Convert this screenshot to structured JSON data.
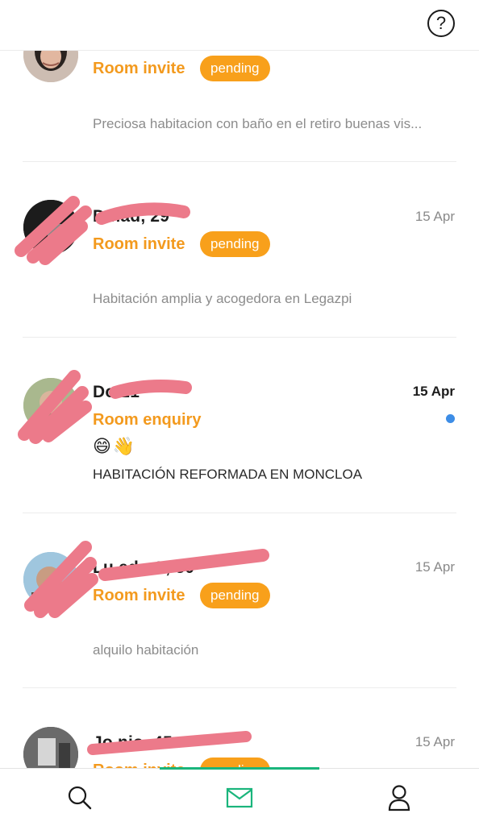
{
  "header": {
    "help_icon": "help-circle-icon",
    "help_label": "?"
  },
  "conversations": [
    {
      "name": "",
      "date": "",
      "type": "Room invite",
      "status": "pending",
      "preview": "Preciosa habitacion con baño en el retiro buenas vis..."
    },
    {
      "name": "D        nad, 29",
      "date": "15 Apr",
      "type": "Room invite",
      "status": "pending",
      "preview": "Habitación amplia y acogedora en Legazpi"
    },
    {
      "name": "Do      21",
      "date": "15 Apr",
      "type": "Room enquiry",
      "status": "",
      "emoji": "😄👋",
      "preview": "HABITACIÓN REFORMADA EN MONCLOA",
      "unread": true
    },
    {
      "name": "Lu        edo S, 50",
      "date": "15 Apr",
      "type": "Room invite",
      "status": "pending",
      "preview": "alquilo habitación"
    },
    {
      "name": "Jo          nio, 45",
      "date": "15 Apr",
      "type": "Room invite",
      "status": "pending",
      "preview": ""
    }
  ],
  "tabbar": {
    "tabs": [
      {
        "id": "search",
        "icon": "search-icon"
      },
      {
        "id": "messages",
        "icon": "mail-icon",
        "active": true
      },
      {
        "id": "profile",
        "icon": "user-icon"
      }
    ],
    "active_color": "#1ab57c"
  },
  "colors": {
    "accent": "#f39a1e",
    "badge": "#f8a01b",
    "unread": "#3d8de6",
    "redaction": "#ec7a8a"
  }
}
